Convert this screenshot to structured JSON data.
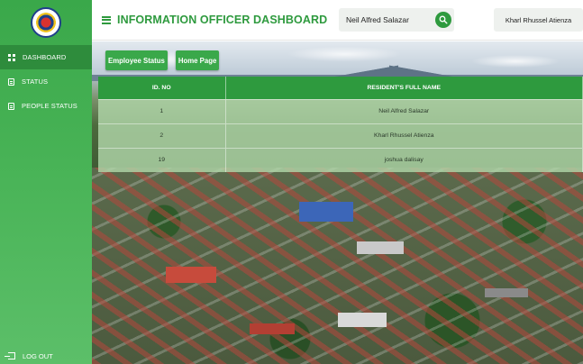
{
  "sidebar": {
    "items": [
      {
        "label": "DASHBOARD",
        "icon": "grid-icon",
        "active": true
      },
      {
        "label": "STATUS",
        "icon": "document-icon",
        "active": false
      },
      {
        "label": "PEOPLE STATUS",
        "icon": "document-icon",
        "active": false
      }
    ],
    "logout_label": "LOG OUT"
  },
  "header": {
    "title": "INFORMATION OFFICER DASHBOARD",
    "search": {
      "value": "Neil Alfred Salazar",
      "icon": "search-icon"
    },
    "user_name": "Kharl Rhussel Atienza"
  },
  "main": {
    "buttons": {
      "employee_status": "Employee Status",
      "home_page": "Home Page"
    },
    "table": {
      "headers": [
        "ID. NO",
        "RESIDENT'S FULL NAME"
      ],
      "rows": [
        {
          "id": "1",
          "name": "Neil Alfred Salazar"
        },
        {
          "id": "2",
          "name": "Kharl Rhussel Atienza"
        },
        {
          "id": "19",
          "name": "joshua dalisay"
        }
      ]
    }
  },
  "colors": {
    "brand_green": "#2e9a3e",
    "sidebar_green": "#48b356",
    "active_item": "#2e8c3c"
  }
}
